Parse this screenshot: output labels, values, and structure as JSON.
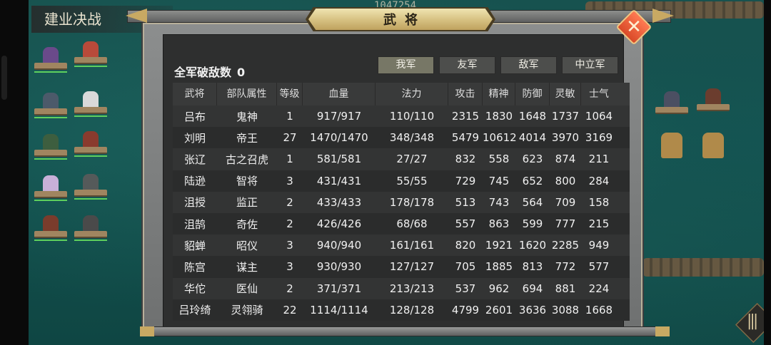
{
  "scene": {
    "battle_title": "建业决战",
    "top_score": "1047254"
  },
  "dialog": {
    "title": "武将",
    "close_label": "✕"
  },
  "summary": {
    "kills_label": "全军破敌数",
    "kills_value": "0"
  },
  "tabs": [
    {
      "label": "我军",
      "active": true
    },
    {
      "label": "友军",
      "active": false
    },
    {
      "label": "敌军",
      "active": false
    },
    {
      "label": "中立军",
      "active": false
    }
  ],
  "table": {
    "headers": [
      "武将",
      "部队属性",
      "等级",
      "血量",
      "法力",
      "攻击",
      "精神",
      "防御",
      "灵敏",
      "士气"
    ],
    "rows": [
      [
        "吕布",
        "鬼神",
        "1",
        "917/917",
        "110/110",
        "2315",
        "1830",
        "1648",
        "1737",
        "1064"
      ],
      [
        "刘明",
        "帝王",
        "27",
        "1470/1470",
        "348/348",
        "5479",
        "10612",
        "4014",
        "3970",
        "3169"
      ],
      [
        "张辽",
        "古之召虎",
        "1",
        "581/581",
        "27/27",
        "832",
        "558",
        "623",
        "874",
        "211"
      ],
      [
        "陆逊",
        "智将",
        "3",
        "431/431",
        "55/55",
        "729",
        "745",
        "652",
        "800",
        "284"
      ],
      [
        "沮授",
        "监正",
        "2",
        "433/433",
        "178/178",
        "513",
        "743",
        "564",
        "709",
        "158"
      ],
      [
        "沮鹄",
        "奇佐",
        "2",
        "426/426",
        "68/68",
        "557",
        "863",
        "599",
        "777",
        "215"
      ],
      [
        "貂蝉",
        "昭仪",
        "3",
        "940/940",
        "161/161",
        "820",
        "1921",
        "1620",
        "2285",
        "949"
      ],
      [
        "陈宫",
        "谋主",
        "3",
        "930/930",
        "127/127",
        "705",
        "1885",
        "813",
        "772",
        "577"
      ],
      [
        "华佗",
        "医仙",
        "2",
        "371/371",
        "213/213",
        "537",
        "962",
        "694",
        "881",
        "224"
      ],
      [
        "吕玲绮",
        "灵翎骑",
        "22",
        "1114/1114",
        "128/128",
        "4799",
        "2601",
        "3636",
        "3088",
        "1668"
      ]
    ]
  },
  "colors": {
    "water": "#135250",
    "panel": "#2e2f2f",
    "gold": "#c8a963",
    "close": "#e65a34"
  },
  "icons": {
    "close": "close-icon",
    "menu": "menu-icon"
  }
}
